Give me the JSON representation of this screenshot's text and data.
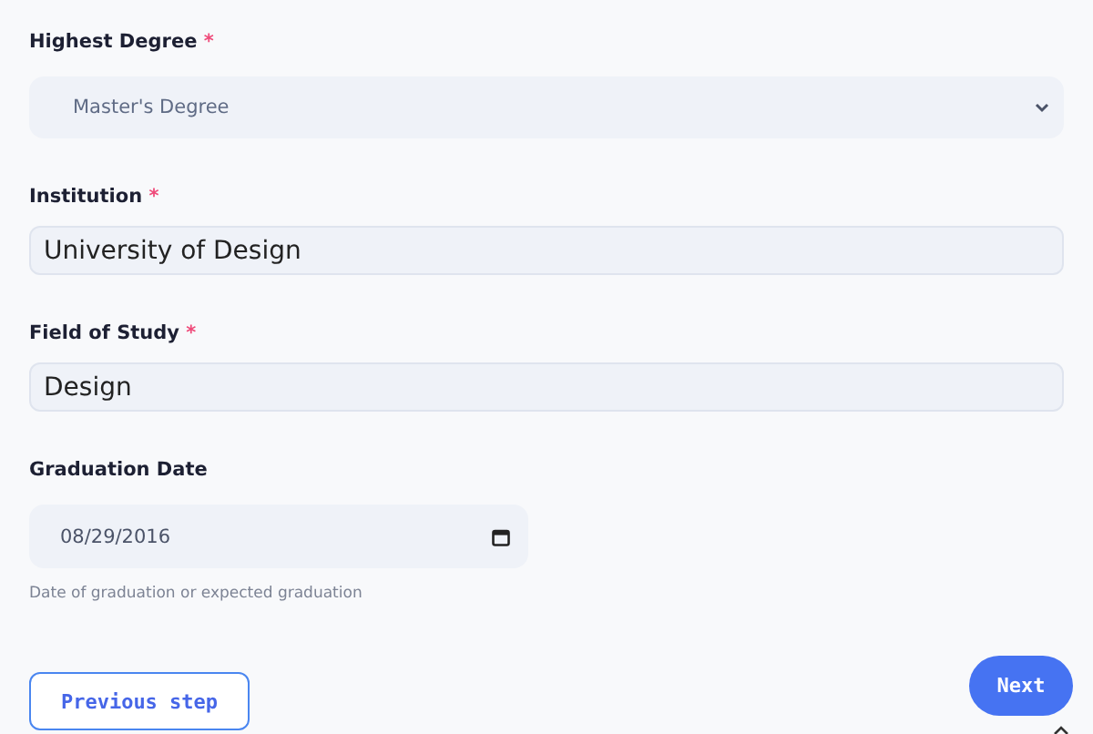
{
  "required_mark": "*",
  "fields": [
    {
      "kind": "select",
      "label": "Highest Degree",
      "required": true,
      "value": "Master's Degree"
    },
    {
      "kind": "text",
      "label": "Institution",
      "required": true,
      "value": "University of Design"
    },
    {
      "kind": "text",
      "label": "Field of Study",
      "required": true,
      "value": "Design"
    },
    {
      "kind": "date",
      "label": "Graduation Date",
      "required": false,
      "value": "08/29/2016",
      "hint": "Date of graduation or expected graduation"
    }
  ],
  "buttons": {
    "previous": "Previous step",
    "next": "Next"
  }
}
